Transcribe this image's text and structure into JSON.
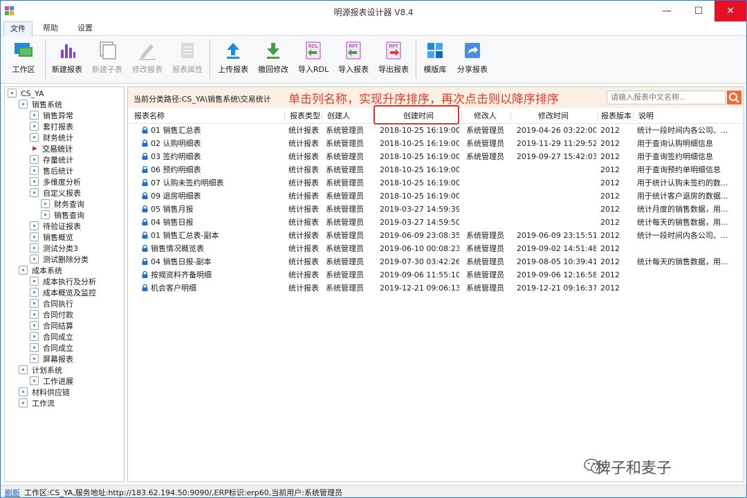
{
  "window": {
    "title": "明源报表设计器 V8.4",
    "minimize": "—",
    "maximize": "☐",
    "close": "✕"
  },
  "menu": {
    "tabs": [
      {
        "label": "文件",
        "active": true
      },
      {
        "label": "帮助",
        "active": false
      },
      {
        "label": "设置",
        "active": false
      }
    ]
  },
  "ribbon": {
    "workspace": "工作区",
    "new_report": "新建报表",
    "new_subreport": "新建子表",
    "edit_report": "修改报表",
    "report_props": "报表属性",
    "upload_report": "上传报表",
    "undo_edit": "撤回修改",
    "import_rdl": "导入RDL",
    "import_report": "导入报表",
    "export_report": "导出报表",
    "template_lib": "模版库",
    "share_report": "分享报表",
    "rdl_tag": "RDL",
    "rpt_tag": "RPT"
  },
  "tree": {
    "items": [
      {
        "label": "CS_YA"
      },
      {
        "label": "销售系统"
      },
      {
        "label": "销售异常"
      },
      {
        "label": "套打报表"
      },
      {
        "label": "财务统计"
      },
      {
        "label": "交易统计",
        "selected": true
      },
      {
        "label": "存量统计"
      },
      {
        "label": "售后统计"
      },
      {
        "label": "多维度分析"
      },
      {
        "label": "自定义报表"
      },
      {
        "label": "财务查询"
      },
      {
        "label": "销售查询"
      },
      {
        "label": "待验证报表"
      },
      {
        "label": "销售概览"
      },
      {
        "label": "测试分类3"
      },
      {
        "label": "测试删除分类"
      },
      {
        "label": "成本系统"
      },
      {
        "label": "成本执行及分析"
      },
      {
        "label": "成本概览及监控"
      },
      {
        "label": "合同执行"
      },
      {
        "label": "合同付款"
      },
      {
        "label": "合同结算"
      },
      {
        "label": "合同成立"
      },
      {
        "label": "合同成立"
      },
      {
        "label": "屏幕报表"
      },
      {
        "label": "计划系统"
      },
      {
        "label": "工作进展"
      },
      {
        "label": "材料供应链"
      },
      {
        "label": "工作流"
      }
    ]
  },
  "pathbar": {
    "path": "当前分类路径:CS_YA\\销售系统\\交易统计",
    "hint": "单击列名称，实现升序排序，再次点击则以降序排序",
    "search_placeholder": "请输入报表中文名称..."
  },
  "table": {
    "columns": [
      "报表名称",
      "报表类型",
      "创建人",
      "创建时间",
      "修改人",
      "修改时间",
      "报表版本",
      "说明"
    ],
    "rows": [
      {
        "name": "01 销售汇总表",
        "type": "统计报表",
        "creator": "系统管理员",
        "created": "2018-10-25 16:19:00",
        "modifier": "系统管理员",
        "modified": "2019-04-26 03:22:00",
        "version": "2012",
        "desc": "统计一段时间内各公司、..."
      },
      {
        "name": "02 认购明细表",
        "type": "统计报表",
        "creator": "系统管理员",
        "created": "2018-10-25 16:19:00",
        "modifier": "系统管理员",
        "modified": "2019-11-29 11:29:52",
        "version": "2012",
        "desc": "用于查询认购明细信息"
      },
      {
        "name": "03 签约明细表",
        "type": "统计报表",
        "creator": "系统管理员",
        "created": "2018-10-25 16:19:00",
        "modifier": "系统管理员",
        "modified": "2019-09-27 15:42:03",
        "version": "2012",
        "desc": "用于查询签约明细信息"
      },
      {
        "name": "06 预约明细表",
        "type": "统计报表",
        "creator": "系统管理员",
        "created": "2018-10-25 16:19:00",
        "modifier": "",
        "modified": "",
        "version": "2012",
        "desc": "用于查询预约单明细信息"
      },
      {
        "name": "07 认购未签约明细表",
        "type": "统计报表",
        "creator": "系统管理员",
        "created": "2018-10-25 16:19:00",
        "modifier": "",
        "modified": "",
        "version": "2012",
        "desc": "用于统计认购未签约的数..."
      },
      {
        "name": "09 退房明细表",
        "type": "统计报表",
        "creator": "系统管理员",
        "created": "2018-10-25 16:19:00",
        "modifier": "",
        "modified": "",
        "version": "2012",
        "desc": "用于统计客户退房的数据..."
      },
      {
        "name": "05 销售月报",
        "type": "统计报表",
        "creator": "系统管理员",
        "created": "2019-03-27 14:59:39",
        "modifier": "",
        "modified": "",
        "version": "2012",
        "desc": "统计月度的销售数据，用..."
      },
      {
        "name": "04 销售日报",
        "type": "统计报表",
        "creator": "系统管理员",
        "created": "2019-03-27 14:59:50",
        "modifier": "",
        "modified": "",
        "version": "2012",
        "desc": "统计每天的销售数据，用..."
      },
      {
        "name": "01 销售汇总表-副本",
        "type": "统计报表",
        "creator": "系统管理员",
        "created": "2019-06-09 23:08:35",
        "modifier": "系统管理员",
        "modified": "2019-06-09 23:15:51",
        "version": "2012",
        "desc": "统计一段时间内各公司、..."
      },
      {
        "name": "销售情况概览表",
        "type": "统计报表",
        "creator": "系统管理员",
        "created": "2019-06-10 00:08:23",
        "modifier": "系统管理员",
        "modified": "2019-09-02 14:51:48",
        "version": "2012",
        "desc": ""
      },
      {
        "name": "04 销售日报-副本",
        "type": "统计报表",
        "creator": "系统管理员",
        "created": "2019-07-30 03:42:26",
        "modifier": "系统管理员",
        "modified": "2019-08-05 10:39:41",
        "version": "2012",
        "desc": "统计每天的销售数据，用..."
      },
      {
        "name": "按揭资料齐备明细",
        "type": "统计报表",
        "creator": "系统管理员",
        "created": "2019-09-06 11:55:10",
        "modifier": "系统管理员",
        "modified": "2019-09-06 12:16:58",
        "version": "2012",
        "desc": ""
      },
      {
        "name": "机会客户明细",
        "type": "统计报表",
        "creator": "系统管理员",
        "created": "2019-12-21 09:06:13",
        "modifier": "系统管理员",
        "modified": "2019-12-21 09:16:37",
        "version": "2012",
        "desc": ""
      }
    ]
  },
  "watermark": "稗子和麦子",
  "status": {
    "refresh": "刷新",
    "text": "工作区:CS_YA,服务地址:http://183.62.194.50:9090/,ERP标识:erp60,当前用户:系统管理员"
  },
  "colors": {
    "accent": "#2b78d0",
    "hint_red": "#e8382a",
    "path_bg": "#fcefe3",
    "search_btn": "#f26a3c",
    "close_btn": "#e81123"
  }
}
